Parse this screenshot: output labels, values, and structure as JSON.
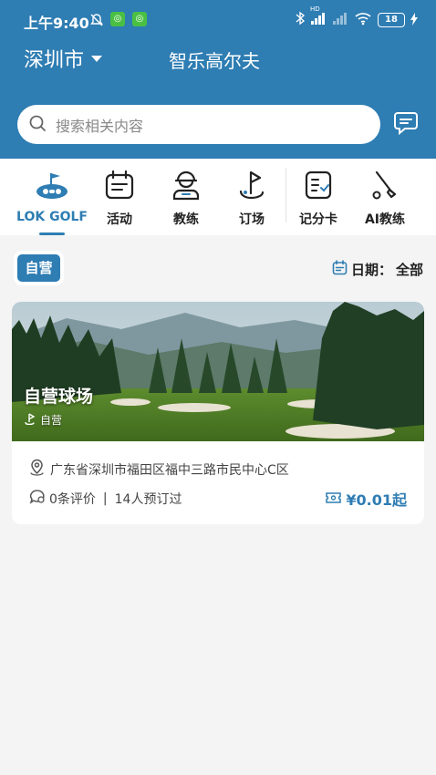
{
  "status_bar": {
    "time": "上午9:40",
    "hd_label": "HD",
    "battery": "18"
  },
  "header": {
    "city": "深圳市",
    "brand": "智乐高尔夫"
  },
  "search": {
    "placeholder": "搜索相关内容"
  },
  "nav": {
    "items": [
      {
        "label": "LOK GOLF",
        "icon": "golf-logo-icon",
        "active": true
      },
      {
        "label": "活动",
        "icon": "calendar-icon"
      },
      {
        "label": "教练",
        "icon": "coach-icon"
      },
      {
        "label": "订场",
        "icon": "flag-icon"
      },
      {
        "label": "记分卡",
        "icon": "scorecard-icon"
      },
      {
        "label": "AI教练",
        "icon": "golf-club-icon"
      }
    ]
  },
  "filter": {
    "tag": "自营",
    "date_label": "日期：",
    "date_value": "全部"
  },
  "venue": {
    "title": "自营球场",
    "subtitle": "自营",
    "address": "广东省深圳市福田区福中三路市民中心C区",
    "reviews": "0条评价",
    "separator": "|",
    "bookings": "14人预订过",
    "price": "¥0.01起"
  },
  "colors": {
    "primary": "#2e7db3",
    "background": "#f4f4f4"
  }
}
